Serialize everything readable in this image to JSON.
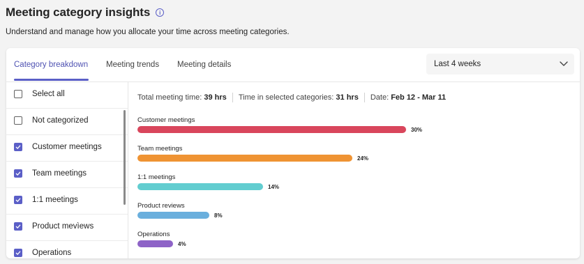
{
  "page": {
    "title": "Meeting category insights",
    "info_icon": "i",
    "subtitle": "Understand and manage how you allocate your time across meeting categories."
  },
  "tabs": [
    {
      "label": "Category breakdown",
      "active": true
    },
    {
      "label": "Meeting trends",
      "active": false
    },
    {
      "label": "Meeting details",
      "active": false
    }
  ],
  "date_range": {
    "selected": "Last 4 weeks"
  },
  "categories": [
    {
      "label": "Select all",
      "checked": false
    },
    {
      "label": "Not categorized",
      "checked": false
    },
    {
      "label": "Customer meetings",
      "checked": true
    },
    {
      "label": "Team meetings",
      "checked": true
    },
    {
      "label": "1:1 meetings",
      "checked": true
    },
    {
      "label": "Product mevìews",
      "checked": true
    },
    {
      "label": "Operations",
      "checked": true
    }
  ],
  "summary": {
    "total_label": "Total meeting time:",
    "total_value": "39 hrs",
    "selected_label": "Time in selected categories:",
    "selected_value": "31 hrs",
    "date_label": "Date:",
    "date_value": "Feb 12 - Mar 11"
  },
  "chart_data": {
    "type": "bar",
    "orientation": "horizontal",
    "categories": [
      "Customer meetings",
      "Team meetings",
      "1:1 meetings",
      "Product reviews",
      "Operations"
    ],
    "values": [
      30,
      24,
      14,
      8,
      4
    ],
    "value_labels": [
      "30%",
      "24%",
      "14%",
      "8%",
      "4%"
    ],
    "unit": "%",
    "colors": [
      "#d9465c",
      "#ef9333",
      "#62cdd0",
      "#6aafdd",
      "#8e63c7"
    ]
  }
}
